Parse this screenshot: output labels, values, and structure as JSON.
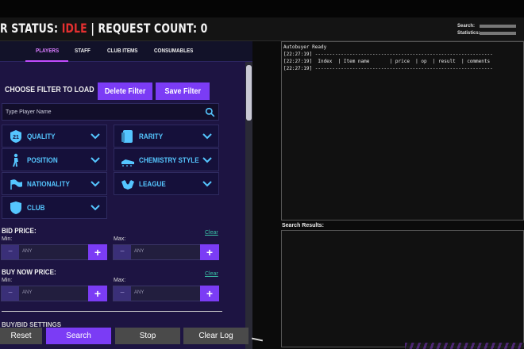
{
  "header": {
    "status_prefix": "R STATUS: ",
    "status_value": "IDLE",
    "request_text": " | REQUEST COUNT: 0",
    "stats": {
      "search_label": "Search:",
      "statistics_label": "Statistics:"
    }
  },
  "tabs": [
    "PLAYERS",
    "STAFF",
    "CLUB ITEMS",
    "CONSUMABLES"
  ],
  "filter": {
    "choose_label": "CHOOSE FILTER TO LOAD",
    "chevron": "⌄",
    "delete_label": "Delete Filter",
    "save_label": "Save Filter"
  },
  "search": {
    "placeholder": "Type Player Name"
  },
  "filters": [
    {
      "label": "QUALITY",
      "icon": "quality-badge-icon"
    },
    {
      "label": "RARITY",
      "icon": "rarity-card-icon"
    },
    {
      "label": "POSITION",
      "icon": "player-position-icon"
    },
    {
      "label": "CHEMISTRY STYLE",
      "icon": "boot-icon"
    },
    {
      "label": "NATIONALITY",
      "icon": "flag-icon"
    },
    {
      "label": "LEAGUE",
      "icon": "league-icon"
    },
    {
      "label": "CLUB",
      "icon": "shield-icon"
    }
  ],
  "bid_price": {
    "title": "BID PRICE:",
    "clear": "Clear",
    "min": "Min:",
    "max": "Max:",
    "min_value": "ANY",
    "max_value": "ANY"
  },
  "buy_now": {
    "title": "BUY NOW PRICE:",
    "clear": "Clear",
    "min": "Min:",
    "max": "Max:",
    "min_value": "ANY",
    "max_value": "ANY"
  },
  "cutoff_text": "BUY/BID SETTINGS",
  "buttons": {
    "reset": "Reset",
    "search": "Search",
    "stop": "Stop",
    "clear_log": "Clear Log"
  },
  "log": {
    "lines": [
      "Autobuyer Ready",
      "[22:27:19] --------------------------------------------------------------",
      "[22:27:19]  Index  | Item name       | price  | op  | result  | comments",
      "[22:27:19] --------------------------------------------------------------"
    ]
  },
  "results": {
    "title": "Search Results:"
  },
  "colors": {
    "accent": "#7b3cf5",
    "idle": "#e53030",
    "filter_label": "#55c6ff",
    "panel_bg": "#1d1442"
  }
}
